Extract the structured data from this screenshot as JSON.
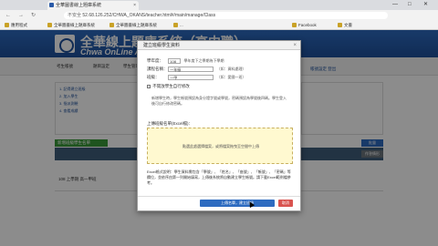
{
  "browser": {
    "tab_title": "全華圖書線上題庫系統",
    "tab_close": "×",
    "window_controls": {
      "minimize": "—",
      "maximize": "□",
      "close": "✕"
    },
    "security_label": "不安全",
    "url": "52.68.126.252/CHWA_OKANS/teacher.html#/main/manage/Class",
    "nav": {
      "back": "←",
      "forward": "→",
      "reload": "↻"
    },
    "bookmarks": [
      "應用程式",
      "全華圖書線上題庫系統",
      "全華圖書線上題庫系統",
      "...",
      "Facebook",
      "文書"
    ]
  },
  "site": {
    "title": "全華線上題庫系統（高中職）",
    "subtitle": "Chwa OnLine Assessment",
    "menu": [
      "考生帳號",
      "題目設定",
      "學生管理",
      "班級管理"
    ],
    "right_links": "帳號設定 登出",
    "side_lines": [
      "1. 記得建立班級",
      "2. 加入學生",
      "3. 指派測驗",
      "4. 查看成績"
    ],
    "green_button": "新增班級學生名單",
    "batch_button": "批量",
    "response_button": "作答情形",
    "row_text": "108 上學期 高一甲班"
  },
  "modal": {
    "title": "建立班級學生資料",
    "close": "×",
    "fields": {
      "year_label": "學年度：",
      "year_value": "108",
      "year_hint": "學年度下之學期為下學期",
      "grade_label": "課程名稱：",
      "grade_value": "一年級",
      "grade_hint": "（如：資料處理）",
      "class_label": "班級：",
      "class_value": "一甲",
      "class_hint": "（如：愛國一班）"
    },
    "checkbox_label": "不開放學生自行修改",
    "note": "新增學生時，學生帳號預設為身分證字號或學號，密碼預設為學號後四碼。學生登入後可自行修改密碼。",
    "upload_label": "上傳班級名單(Excel檔)：",
    "dropzone_text": "點選此處選擇檔案，或將檔案拖曳至空間中上傳",
    "excel_desc": "Excel格式說明：學生資料需包含「學號」、「姓名」、「座號」、「帳號」、「密碼」等欄位，並依序由第一列開始填寫，上傳後系統將自動建立學生帳號。請下載Excel範例檔參考。",
    "upload_button": "上傳名單，建立班級",
    "cancel_button": "取消"
  }
}
